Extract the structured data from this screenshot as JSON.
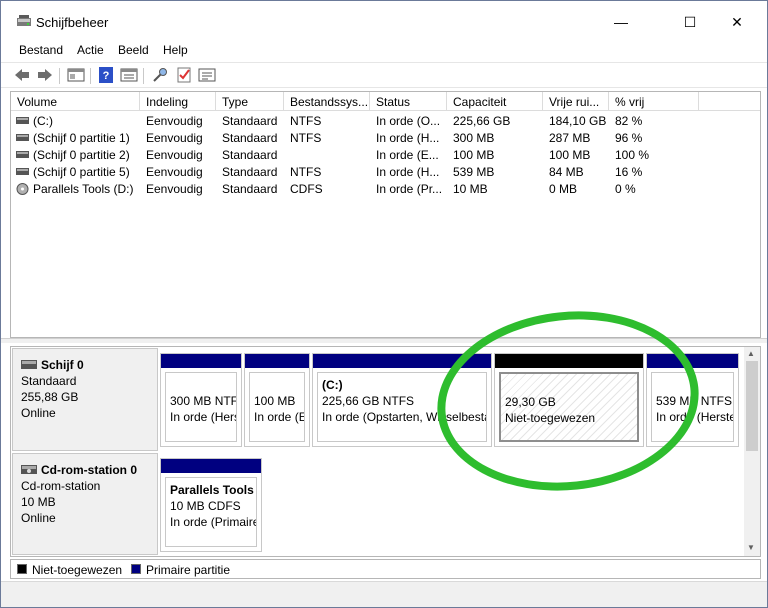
{
  "window": {
    "title": "Schijfbeheer",
    "minimize": "—",
    "maximize": "☐",
    "close": "✕"
  },
  "menu": [
    "Bestand",
    "Actie",
    "Beeld",
    "Help"
  ],
  "toolbar_icons": [
    "back-arrow-icon",
    "forward-arrow-icon",
    "properties-icon",
    "help-icon",
    "settings-list-icon",
    "connect-icon",
    "check-icon",
    "list-icon"
  ],
  "columns": [
    "Volume",
    "Indeling",
    "Type",
    "Bestandssys...",
    "Status",
    "Capaciteit",
    "Vrije rui...",
    "% vrij"
  ],
  "volumes": [
    {
      "volume": "(C:)",
      "indeling": "Eenvoudig",
      "type": "Standaard",
      "fs": "NTFS",
      "status": "In orde (O...",
      "capaciteit": "225,66 GB",
      "vrij": "184,10 GB",
      "pct": "82 %"
    },
    {
      "volume": "(Schijf 0 partitie 1)",
      "indeling": "Eenvoudig",
      "type": "Standaard",
      "fs": "NTFS",
      "status": "In orde (H...",
      "capaciteit": "300 MB",
      "vrij": "287 MB",
      "pct": "96 %"
    },
    {
      "volume": "(Schijf 0 partitie 2)",
      "indeling": "Eenvoudig",
      "type": "Standaard",
      "fs": "",
      "status": "In orde (E...",
      "capaciteit": "100 MB",
      "vrij": "100 MB",
      "pct": "100 %"
    },
    {
      "volume": "(Schijf 0 partitie 5)",
      "indeling": "Eenvoudig",
      "type": "Standaard",
      "fs": "NTFS",
      "status": "In orde (H...",
      "capaciteit": "539 MB",
      "vrij": "84 MB",
      "pct": "16 %"
    },
    {
      "volume": "Parallels Tools (D:)",
      "indeling": "Eenvoudig",
      "type": "Standaard",
      "fs": "CDFS",
      "status": "In orde (Pr...",
      "capaciteit": "10 MB",
      "vrij": "0 MB",
      "pct": "0 %"
    }
  ],
  "disk0": {
    "name": "Schijf 0",
    "type": "Standaard",
    "size": "255,88 GB",
    "state": "Online",
    "partitions": [
      {
        "title": "",
        "size": "300 MB NTFS",
        "status": "In orde (Hers"
      },
      {
        "title": "",
        "size": "100 MB",
        "status": "In orde (E"
      },
      {
        "title": "(C:)",
        "size": "225,66 GB NTFS",
        "status": "In orde (Opstarten, Wisselbesta"
      },
      {
        "title": "",
        "size": "29,30 GB",
        "status": "Niet-toegewezen"
      },
      {
        "title": "",
        "size": "539 MB NTFS",
        "status": "In orde (Herste"
      }
    ]
  },
  "cdrom0": {
    "name": "Cd-rom-station 0",
    "type": "Cd-rom-station",
    "size": "10 MB",
    "state": "Online",
    "partition": {
      "title": "Parallels Tools",
      "size": "10 MB CDFS",
      "status": "In orde (Primaire"
    }
  },
  "legend": [
    {
      "label": "Niet-toegewezen",
      "color": "#000000"
    },
    {
      "label": "Primaire partitie",
      "color": "#000080"
    }
  ],
  "annotation_color": "#2ebd2e"
}
